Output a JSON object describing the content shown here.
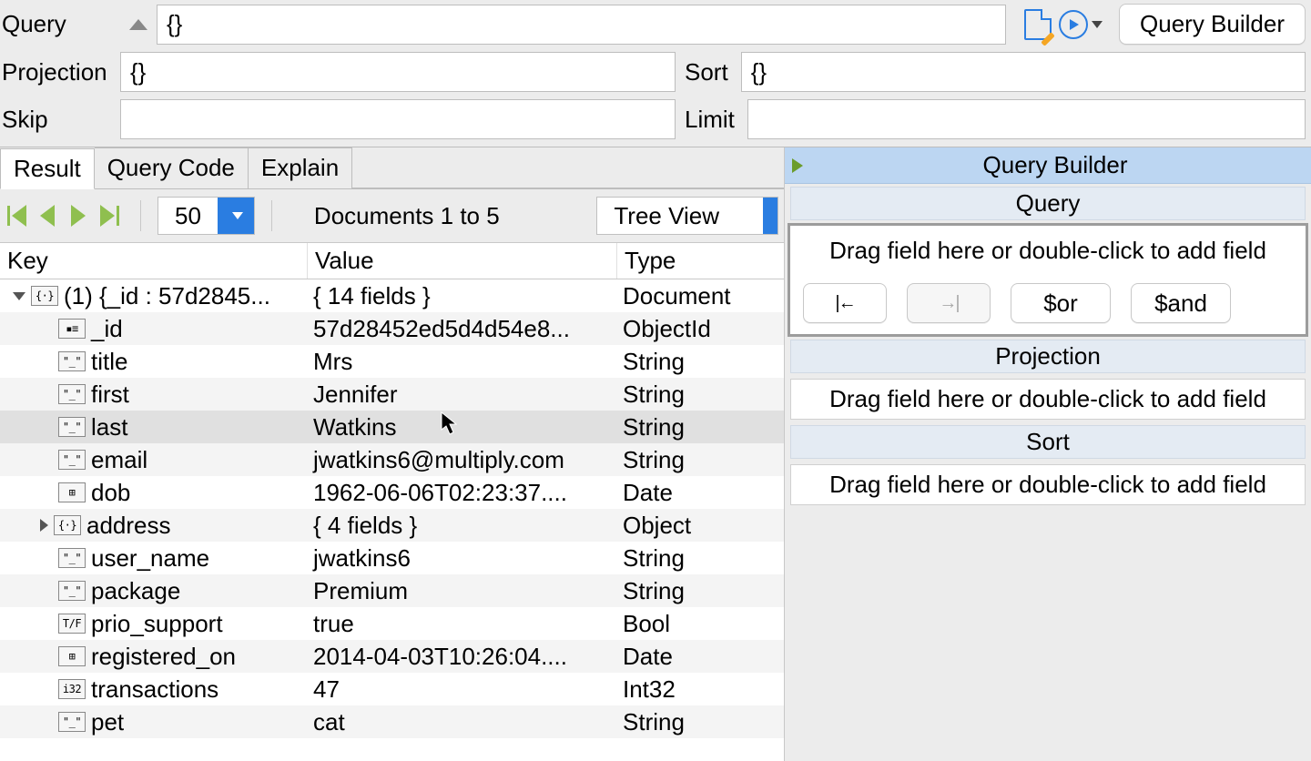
{
  "form": {
    "query_label": "Query",
    "query_value": "{}",
    "projection_label": "Projection",
    "projection_value": "{}",
    "sort_label": "Sort",
    "sort_value": "{}",
    "skip_label": "Skip",
    "skip_value": "",
    "limit_label": "Limit",
    "limit_value": "",
    "query_builder_btn": "Query Builder"
  },
  "tabs": {
    "result": "Result",
    "query_code": "Query Code",
    "explain": "Explain"
  },
  "toolbar": {
    "page_size": "50",
    "doc_range": "Documents 1 to 5",
    "view_mode": "Tree View"
  },
  "tree": {
    "headers": {
      "key": "Key",
      "value": "Value",
      "type": "Type"
    },
    "rows": [
      {
        "depth": 0,
        "disclosure": "open",
        "icon": "{}",
        "key": "(1) {_id : 57d2845...",
        "value": "{ 14 fields }",
        "type": "Document"
      },
      {
        "depth": 1,
        "disclosure": "",
        "icon": "id",
        "key": "_id",
        "value": "57d28452ed5d4d54e8...",
        "type": "ObjectId"
      },
      {
        "depth": 1,
        "disclosure": "",
        "icon": "str",
        "key": "title",
        "value": "Mrs",
        "type": "String"
      },
      {
        "depth": 1,
        "disclosure": "",
        "icon": "str",
        "key": "first",
        "value": "Jennifer",
        "type": "String"
      },
      {
        "depth": 1,
        "disclosure": "",
        "icon": "str",
        "key": "last",
        "value": "Watkins",
        "type": "String",
        "hover": true
      },
      {
        "depth": 1,
        "disclosure": "",
        "icon": "str",
        "key": "email",
        "value": "jwatkins6@multiply.com",
        "type": "String"
      },
      {
        "depth": 1,
        "disclosure": "",
        "icon": "dt",
        "key": "dob",
        "value": "1962-06-06T02:23:37....",
        "type": "Date"
      },
      {
        "depth": 2,
        "disclosure": "closed",
        "icon": "{}",
        "key": "address",
        "value": "{ 4 fields }",
        "type": "Object"
      },
      {
        "depth": 1,
        "disclosure": "",
        "icon": "str",
        "key": "user_name",
        "value": "jwatkins6",
        "type": "String"
      },
      {
        "depth": 1,
        "disclosure": "",
        "icon": "str",
        "key": "package",
        "value": "Premium",
        "type": "String"
      },
      {
        "depth": 1,
        "disclosure": "",
        "icon": "tf",
        "key": "prio_support",
        "value": "true",
        "type": "Bool"
      },
      {
        "depth": 1,
        "disclosure": "",
        "icon": "dt",
        "key": "registered_on",
        "value": "2014-04-03T10:26:04....",
        "type": "Date"
      },
      {
        "depth": 1,
        "disclosure": "",
        "icon": "i32",
        "key": "transactions",
        "value": "47",
        "type": "Int32"
      },
      {
        "depth": 1,
        "disclosure": "",
        "icon": "str",
        "key": "pet",
        "value": "cat",
        "type": "String"
      }
    ]
  },
  "qb": {
    "panel_title": "Query Builder",
    "section_query": "Query",
    "section_projection": "Projection",
    "section_sort": "Sort",
    "drag_hint": "Drag field here or double-click to add field",
    "btn_outdent": "|←",
    "btn_indent": "→|",
    "btn_or": "$or",
    "btn_and": "$and"
  },
  "badge_text": {
    "{}": "{·}",
    "id": "▪≡",
    "str": "\"_\"",
    "dt": "⊞",
    "tf": "T/F",
    "i32": "i32"
  }
}
